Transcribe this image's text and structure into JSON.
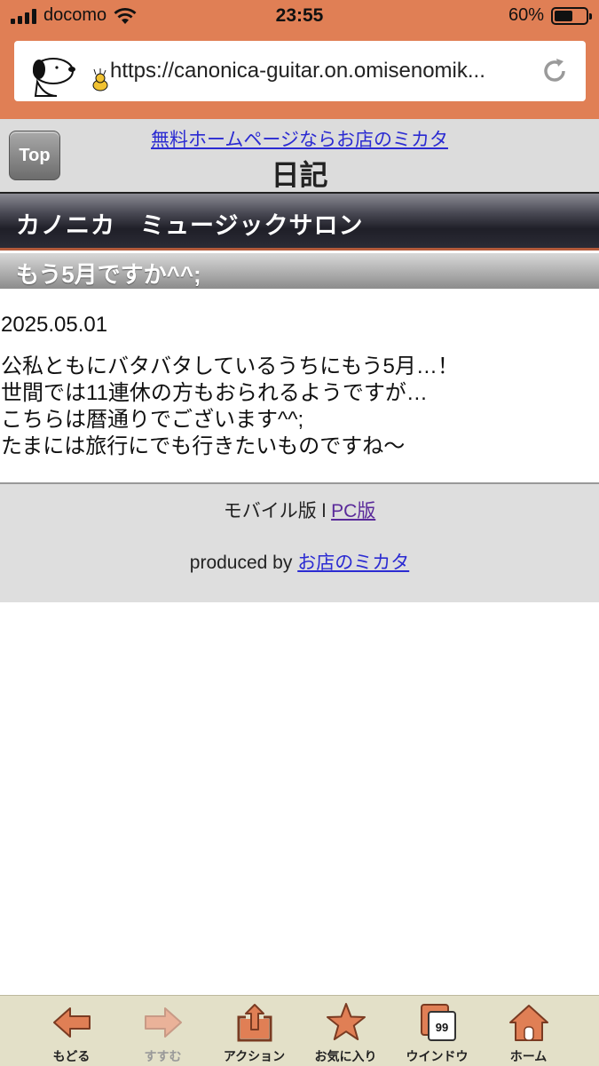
{
  "status_bar": {
    "carrier": "docomo",
    "time": "23:55",
    "battery": "60%",
    "battery_level": 0.6
  },
  "browser": {
    "url": "https://canonica-guitar.on.omisenomik..."
  },
  "header": {
    "top_button": "Top",
    "ad_link": "無料ホームページならお店のミカタ",
    "title": "日記"
  },
  "shop": {
    "name": "カノニカ　ミュージックサロン"
  },
  "post": {
    "title": "もう5月ですか^^;",
    "date": "2025.05.01",
    "lines": [
      "公私ともにバタバタしているうちにもう5月…！",
      "世間では11連休の方もおられるようですが…",
      "こちらは暦通りでございます^^;",
      "たまには旅行にでも行きたいものですね〜"
    ]
  },
  "footer": {
    "mobile_label": "モバイル版 l ",
    "pc_link": "PC版",
    "produced_by": "produced by ",
    "credit_link": "お店のミカタ"
  },
  "toolbar": {
    "items": [
      {
        "label": "もどる",
        "icon": "back-arrow-icon",
        "enabled": true
      },
      {
        "label": "すすむ",
        "icon": "forward-arrow-icon",
        "enabled": false
      },
      {
        "label": "アクション",
        "icon": "share-icon",
        "enabled": true
      },
      {
        "label": "お気に入り",
        "icon": "star-icon",
        "enabled": true
      },
      {
        "label": "ウインドウ",
        "icon": "windows-icon",
        "enabled": true,
        "badge": "99"
      },
      {
        "label": "ホーム",
        "icon": "home-icon",
        "enabled": true
      }
    ]
  },
  "colors": {
    "chrome": "#e07f55",
    "toolbar_icon": "#e07f55",
    "link": "#2b2bd2",
    "visited_link": "#5a2a9a"
  }
}
